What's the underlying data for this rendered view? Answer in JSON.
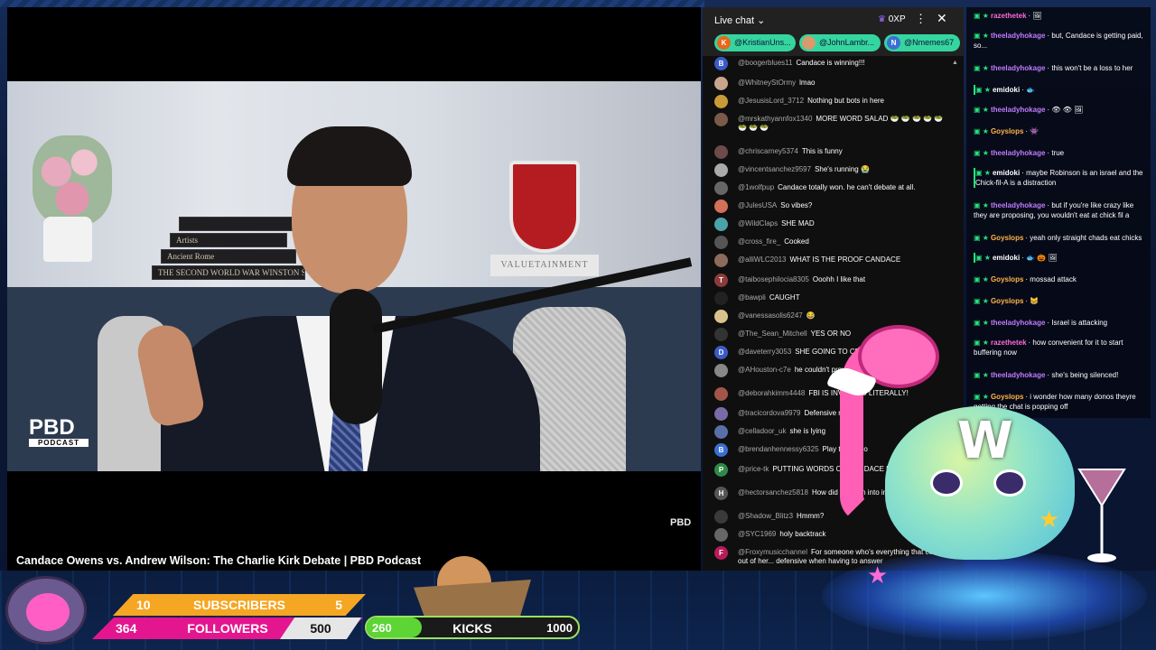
{
  "video": {
    "title": "Candace Owens vs. Andrew Wilson: The Charlie Kirk Debate | PBD Podcast",
    "logo_big": "PBD",
    "logo_small": "PODCAST",
    "corner_logo": "PBD",
    "book_titles": [
      "Artists",
      "Ancient Rome",
      "THE SECOND WORLD WAR WINSTON S."
    ],
    "crest_text": "VALUETAINMENT"
  },
  "chat": {
    "title": "Live chat",
    "xp": "0XP",
    "pins": [
      {
        "initial": "K",
        "label": "@KristianUns...",
        "color": "#e8671c"
      },
      {
        "initial": "",
        "label": "@JohnLambr...",
        "color": "#d99a6c"
      },
      {
        "initial": "N",
        "label": "@Nmemes67",
        "color": "#3b6fd1"
      }
    ],
    "messages": [
      {
        "user": "@boogerblues11",
        "text": "Candace is winning!!!",
        "initial": "B",
        "color": "#3b5bc9"
      },
      {
        "user": "@WhitneyStOrmy",
        "text": "lmao",
        "initial": "",
        "color": "#c9a58c"
      },
      {
        "user": "@JesusisLord_3712",
        "text": "Nothing but bots in here",
        "initial": "",
        "color": "#c99b36"
      },
      {
        "user": "@mrskathyannfox1340",
        "text": "MORE WORD SALAD 🥗 🥗 🥗 🥗 🥗 🥗 🥗 🥗",
        "initial": "",
        "color": "#7a5a48"
      },
      {
        "user": "@chriscarney5374",
        "text": "This is funny",
        "initial": "",
        "color": "#6f4a4a"
      },
      {
        "user": "@vincentsanchez9597",
        "text": "She's running 😭",
        "initial": "",
        "color": "#aaaaaa"
      },
      {
        "user": "@1wolfpup",
        "text": "Candace totally won. he can't debate at all.",
        "initial": "",
        "color": "#666"
      },
      {
        "user": "@JulesUSA",
        "text": "So vibes?",
        "initial": "",
        "color": "#d3705a"
      },
      {
        "user": "@WildClaps",
        "text": "SHE MAD",
        "initial": "",
        "color": "#4aa3a8"
      },
      {
        "user": "@cross_fire_",
        "text": "Cooked",
        "initial": "",
        "color": "#555"
      },
      {
        "user": "@alliWLC2013",
        "text": "WHAT IS THE PROOF CANDACE",
        "initial": "",
        "color": "#8b6c5c"
      },
      {
        "user": "@taibosephilocia8305",
        "text": "Ooohh I like that",
        "initial": "T",
        "color": "#8b3b3b"
      },
      {
        "user": "@bawpli",
        "text": "CAUGHT",
        "initial": "",
        "color": "#222"
      },
      {
        "user": "@vanessasolis6247",
        "text": "😂",
        "initial": "",
        "color": "#d9c38a"
      },
      {
        "user": "@The_Sean_Mitchell",
        "text": "YES OR NO",
        "initial": "",
        "color": "#333"
      },
      {
        "user": "@daveterry3053",
        "text": "SHE GOING TO CRY",
        "initial": "D",
        "color": "#3b5bc9"
      },
      {
        "user": "@AHouston-c7e",
        "text": "he couldn't prove it but thinkshes a lawyer",
        "initial": "",
        "color": "#888"
      },
      {
        "user": "@deborahkimm4448",
        "text": "FBI IS INVOLVED LITERALLY!",
        "initial": "",
        "color": "#a3554a"
      },
      {
        "user": "@tracicordova9979",
        "text": "Defensive much",
        "initial": "",
        "color": "#7a6aa5"
      },
      {
        "user": "@celladoor_uk",
        "text": "she is lying",
        "initial": "",
        "color": "#5a6fa8"
      },
      {
        "user": "@brendanhennessy6325",
        "text": "Play the video",
        "initial": "B",
        "color": "#3b6fd1"
      },
      {
        "user": "@price-tk",
        "text": "PUTTING WORDS ON CANDACE PATHETIC",
        "initial": "P",
        "color": "#2f8a4a"
      },
      {
        "user": "@hectorsanchez5818",
        "text": "How did this turn into interrogating her",
        "initial": "H",
        "color": "#555"
      },
      {
        "user": "@Shadow_Blitz3",
        "text": "Hmmm?",
        "initial": "",
        "color": "#3a3a3a"
      },
      {
        "user": "@SYC1969",
        "text": "holy backtrack",
        "initial": "",
        "color": "#666"
      },
      {
        "user": "@Froxymusicchannel",
        "text": "For someone who's everything that comes out of her... defensive when having to answer",
        "initial": "F",
        "color": "#b71c5a"
      }
    ]
  },
  "twitch_chat": {
    "messages": [
      {
        "user": "razethetek",
        "text": "🖼",
        "color": "#ff6ad5",
        "hl": false
      },
      {
        "user": "theeladyhokage",
        "text": "but, Candace is getting paid, so...",
        "color": "#c07bff",
        "hl": false
      },
      {
        "user": "theeladyhokage",
        "text": "this won't be a loss to her",
        "color": "#c07bff",
        "hl": false
      },
      {
        "user": "emidoki",
        "text": "🐟",
        "color": "#ffffff",
        "hl": true
      },
      {
        "user": "theeladyhokage",
        "text": "👁 👁 🖼",
        "color": "#c07bff",
        "hl": false
      },
      {
        "user": "Goyslops",
        "text": "👾",
        "color": "#ffb347",
        "hl": false
      },
      {
        "user": "theeladyhokage",
        "text": "true",
        "color": "#c07bff",
        "hl": false
      },
      {
        "user": "emidoki",
        "text": "maybe Robinson is an israel and the Chick-fil-A is a distraction",
        "color": "#ffffff",
        "hl": true
      },
      {
        "user": "theeladyhokage",
        "text": "but if you're like crazy like they are proposing, you wouldn't eat at chick fil a",
        "color": "#c07bff",
        "hl": false
      },
      {
        "user": "Goyslops",
        "text": "yeah only straight chads eat chicks",
        "color": "#ffb347",
        "hl": false
      },
      {
        "user": "emidoki",
        "text": "🐟 🎃 🖼",
        "color": "#ffffff",
        "hl": true
      },
      {
        "user": "Goyslops",
        "text": "mossad attack",
        "color": "#ffb347",
        "hl": false
      },
      {
        "user": "Goyslops",
        "text": "😸",
        "color": "#ffb347",
        "hl": false
      },
      {
        "user": "theeladyhokage",
        "text": "Israel is attacking",
        "color": "#c07bff",
        "hl": false
      },
      {
        "user": "razethetek",
        "text": "how convenient for it to start buffering now",
        "color": "#ff6ad5",
        "hl": false
      },
      {
        "user": "theeladyhokage",
        "text": "she's being silenced!",
        "color": "#c07bff",
        "hl": false
      },
      {
        "user": "Goyslops",
        "text": "i wonder how many donos theyre getting the chat is popping off",
        "color": "#ffb347",
        "hl": false
      }
    ]
  },
  "goals": {
    "subscribers": {
      "current": "10",
      "label": "SUBSCRIBERS",
      "target": "5"
    },
    "followers": {
      "current": "364",
      "label": "FOLLOWERS",
      "target": "500"
    },
    "kicks": {
      "current": "260",
      "label": "KICKS",
      "target": "1000",
      "progress": 0.26
    }
  },
  "mascot": {
    "letter": "W"
  }
}
